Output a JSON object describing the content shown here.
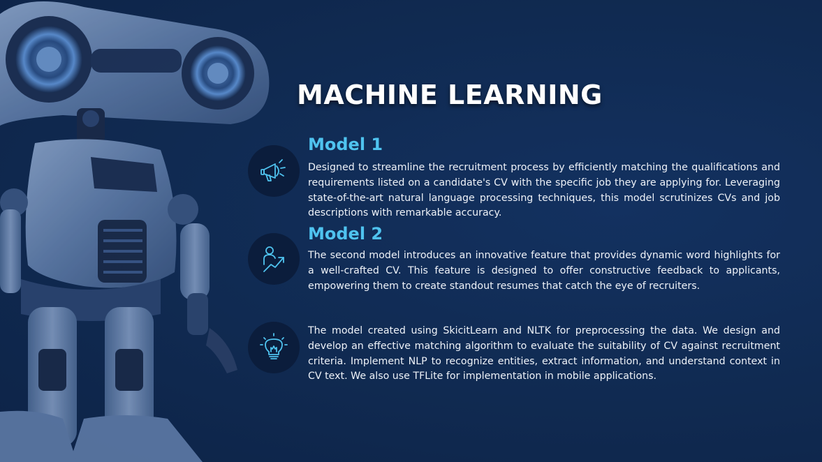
{
  "slide": {
    "title": "MACHINE LEARNING",
    "colors": {
      "background": "#112a52",
      "accent": "#4fc3ef",
      "icon_circle": "#0b1d3c",
      "text": "#eef2f8"
    },
    "items": [
      {
        "icon": "megaphone-icon",
        "heading": "Model 1",
        "text": "Designed to streamline the recruitment process by efficiently matching the qualifications and requirements listed on a candidate's CV with the specific job they are applying for. Leveraging state-of-the-art natural language processing techniques, this model scrutinizes CVs and job descriptions with remarkable accuracy."
      },
      {
        "icon": "person-growth-icon",
        "heading": "Model 2",
        "text": "The second model introduces an innovative feature that provides dynamic word highlights for a well-crafted CV. This feature is designed to offer constructive feedback to applicants, empowering them to create standout resumes that catch the eye of recruiters."
      },
      {
        "icon": "lightbulb-icon",
        "heading": "",
        "text": "The model created using SkicitLearn and NLTK for preprocessing the data. We design and develop an effective matching algorithm to evaluate the suitability of CV against recruitment criteria. Implement NLP to recognize entities, extract information, and understand context in CV text. We also use TFLite for implementation in mobile applications."
      }
    ]
  }
}
